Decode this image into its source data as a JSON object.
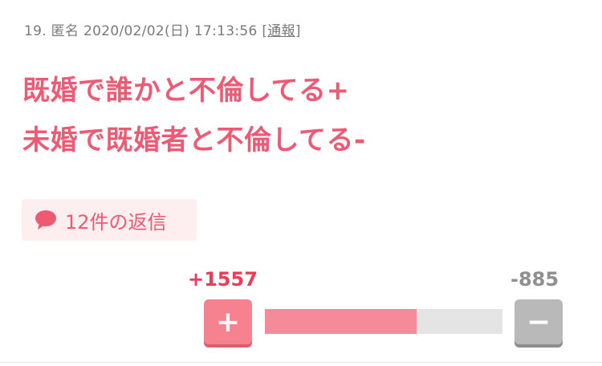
{
  "comment": {
    "number": "19.",
    "author": "匿名",
    "timestamp": "2020/02/02(日) 17:13:56",
    "report_bracket_open": "[",
    "report_label": "通報",
    "report_bracket_close": "]",
    "body_lines": [
      "既婚で誰かと不倫してる+",
      "未婚で既婚者と不倫してる-"
    ]
  },
  "reply": {
    "label": "12件の返信",
    "icon": "speech-bubble-icon"
  },
  "vote": {
    "plus_count": "+1557",
    "minus_count": "-885",
    "plus_symbol": "+",
    "minus_symbol": "−",
    "plus_fraction": 0.64,
    "colors": {
      "plus": "#ee3b57",
      "bar_fill": "#f58a99",
      "bar_empty": "#e4e4e4",
      "minus_button": "#b9b9b9"
    }
  }
}
